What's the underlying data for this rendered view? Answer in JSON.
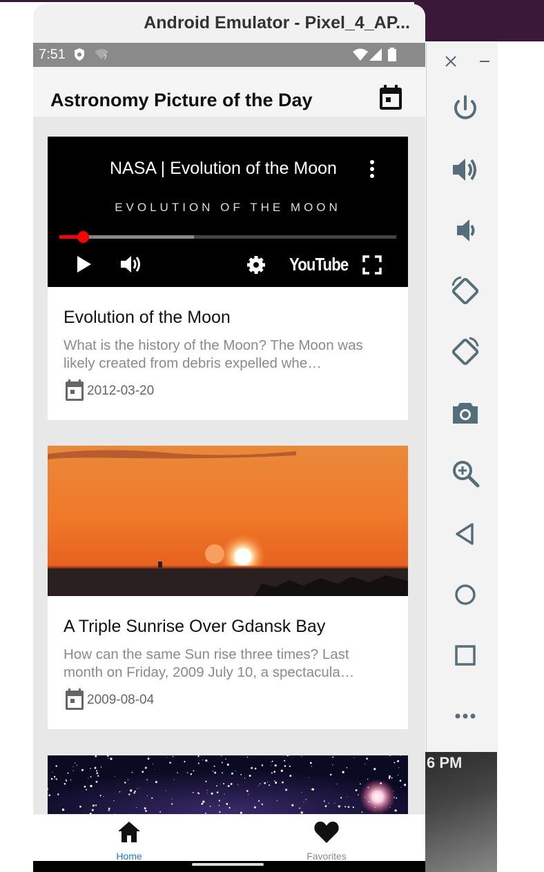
{
  "window": {
    "title": "Android Emulator - Pixel_4_AP..."
  },
  "status_bar": {
    "time": "7:51",
    "icons": [
      "shield-icon",
      "wifi-question-icon",
      "wifi-icon",
      "signal-icon",
      "battery-icon"
    ]
  },
  "app_bar": {
    "title": "Astronomy Picture of the Day",
    "action_icon": "calendar-icon"
  },
  "cards": [
    {
      "media_type": "video",
      "video": {
        "title": "NASA | Evolution of the Moon",
        "subtitle": "EVOLUTION OF THE MOON",
        "brand": "YouTube",
        "progress": 0.07,
        "buffered": 0.4
      },
      "title": "Evolution of the Moon",
      "description": "What is the history of the Moon? The Moon was likely created from debris expelled whe…",
      "date": "2012-03-20"
    },
    {
      "media_type": "image",
      "image_subject": "sunset-over-sea",
      "title": "A Triple Sunrise Over Gdansk Bay",
      "description": "How can the same Sun rise three times? Last month on Friday, 2009 July 10, a spectacula…",
      "date": "2009-08-04"
    },
    {
      "media_type": "image",
      "image_subject": "star-field"
    }
  ],
  "bottom_nav": {
    "items": [
      {
        "label": "Home",
        "icon": "home-icon",
        "active": true
      },
      {
        "label": "Favorites",
        "icon": "heart-icon",
        "active": false
      }
    ],
    "active_color": "#1976d2"
  },
  "emulator_toolbar": {
    "window_controls": [
      "close-icon",
      "minimize-icon"
    ],
    "buttons": [
      "power-icon",
      "volume-up-icon",
      "volume-down-icon",
      "rotate-left-icon",
      "rotate-right-icon",
      "camera-icon",
      "zoom-icon",
      "back-icon",
      "home-circle-icon",
      "overview-icon",
      "more-icon"
    ]
  },
  "desktop": {
    "clock_fragment": "6 PM"
  }
}
